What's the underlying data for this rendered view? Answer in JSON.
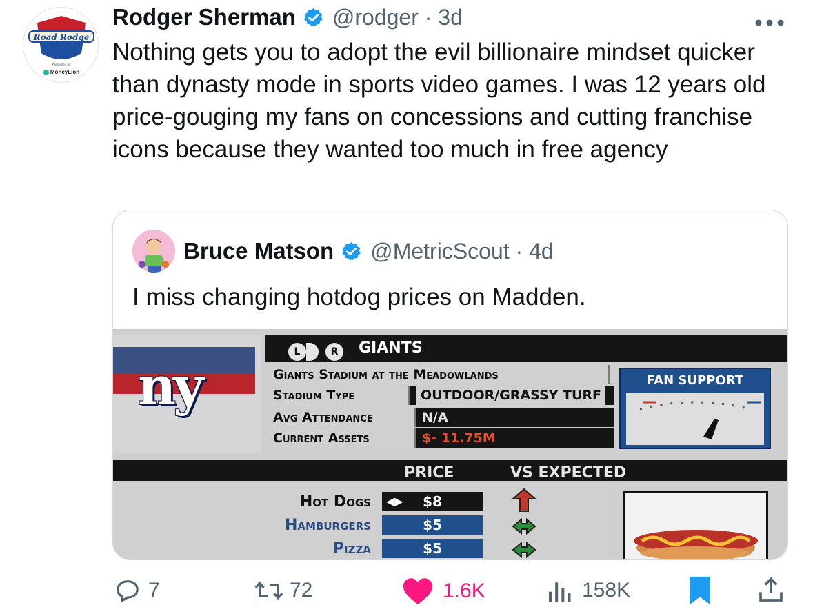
{
  "tweet": {
    "author_name": "Rodger Sherman",
    "handle_time": "@rodger · 3d",
    "text": "Nothing gets you to adopt the evil billionaire mindset quicker than dynasty mode in sports video games. I was 12 years old price-gouging my fans on concessions and cutting franchise icons because they wanted too much in free agency",
    "avatar": {
      "logo_text": "Road Rodge",
      "sponsor_small": "Presented by",
      "sponsor": "MoneyLion"
    },
    "more_icon": "more-horizontal-icon"
  },
  "quote": {
    "author_name": "Bruce Matson",
    "handle_time": "@MetricScout · 4d",
    "text": "I miss changing hotdog prices on Madden.",
    "game": {
      "btn_left": "L",
      "btn_right": "R",
      "team": "GIANTS",
      "logo": "ny",
      "stadium_name": "Giants Stadium at the Meadowlands",
      "stadium_type_label": "Stadium Type",
      "stadium_type_value": "OUTDOOR/GRASSY TURF",
      "attendance_label": "Avg Attendance",
      "attendance_value": "N/A",
      "assets_label": "Current Assets",
      "assets_value": "$- 11.75M",
      "fan_support_label": "FAN SUPPORT",
      "col_price": "PRICE",
      "col_vs_expected": "VS EXPECTED",
      "items": [
        {
          "name": "Hot Dogs",
          "price": "$8",
          "trend": "up"
        },
        {
          "name": "Hamburgers",
          "price": "$5",
          "trend": "neutral"
        },
        {
          "name": "Pizza",
          "price": "$5",
          "trend": "neutral"
        }
      ]
    }
  },
  "actions": {
    "replies": "7",
    "retweets": "72",
    "likes": "1.6K",
    "views": "158K"
  },
  "colors": {
    "verified": "#1d9bf0",
    "like": "#f91880",
    "bookmark": "#1d9bf0",
    "muted": "#536471"
  }
}
